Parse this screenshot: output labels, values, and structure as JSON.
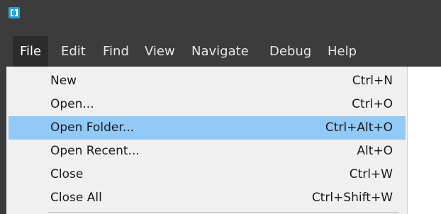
{
  "window": {
    "app_icon_name": "brackets-app-icon"
  },
  "menubar": {
    "items": [
      {
        "label": "File"
      },
      {
        "label": "Edit"
      },
      {
        "label": "Find"
      },
      {
        "label": "View"
      },
      {
        "label": "Navigate"
      },
      {
        "label": "Debug"
      },
      {
        "label": "Help"
      }
    ]
  },
  "file_menu": {
    "items": [
      {
        "label": "New",
        "shortcut": "Ctrl+N"
      },
      {
        "label": "Open...",
        "shortcut": "Ctrl+O"
      },
      {
        "label": "Open Folder...",
        "shortcut": "Ctrl+Alt+O",
        "highlighted": true
      },
      {
        "label": "Open Recent...",
        "shortcut": "Alt+O"
      },
      {
        "label": "Close",
        "shortcut": "Ctrl+W"
      },
      {
        "label": "Close All",
        "shortcut": "Ctrl+Shift+W"
      }
    ]
  },
  "colors": {
    "chrome": "#3c3c3c",
    "menu_active": "#2b2b2b",
    "dropdown_bg": "#f0f0f0",
    "highlight": "#91c9f7",
    "icon_blue": "#29a3db"
  }
}
